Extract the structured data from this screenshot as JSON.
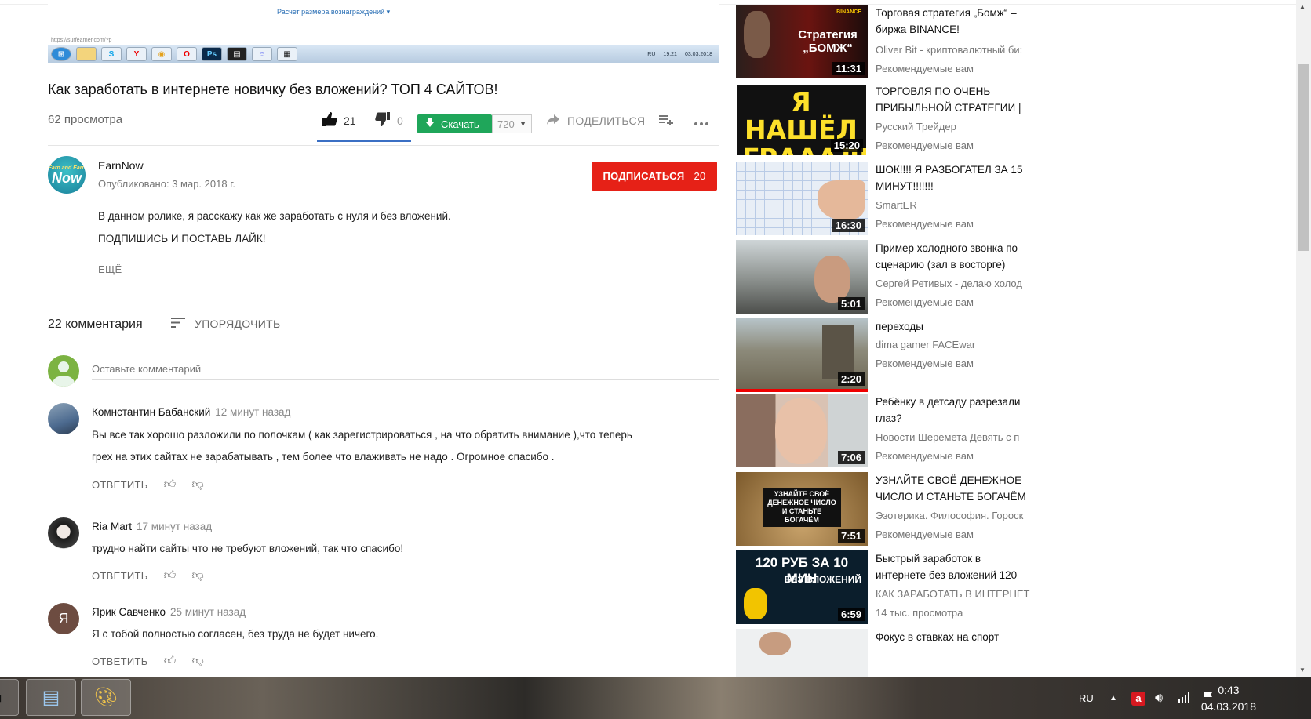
{
  "player": {
    "reward_link": "Расчет размера вознаграждений ▾",
    "url_text": "https://surfearner.com/?p",
    "mini_tray_lang": "RU",
    "mini_tray_time": "19:21",
    "mini_tray_date": "03.03.2018"
  },
  "video": {
    "title": "Как заработать в интернете новичку без вложений? ТОП 4 САЙТОВ!",
    "views": "62 просмотра",
    "likes": "21",
    "dislikes": "0",
    "download_label": "Скачать",
    "quality": "720",
    "share_label": "ПОДЕЛИТЬСЯ"
  },
  "channel": {
    "name": "EarnNow",
    "avatar_small": "Earn and Earn",
    "avatar_big": "Now",
    "published": "Опубликовано: 3 мар. 2018 г.",
    "subscribe_label": "ПОДПИСАТЬСЯ",
    "subscriber_count": "20"
  },
  "description": {
    "line1": "В данном ролике, я расскажу как же заработать с нуля и без вложений.",
    "line2": "ПОДПИШИСЬ И ПОСТАВЬ ЛАЙК!",
    "more": "ЕЩЁ"
  },
  "comments_section": {
    "count": "22 комментария",
    "sort_label": "УПОРЯДОЧИТЬ",
    "input_placeholder": "Оставьте комментарий",
    "reply_label": "ОТВЕТИТЬ",
    "items": [
      {
        "author": "Комнстантин Бабанский",
        "time": "12 минут назад",
        "text1": "Вы все так хорошо разложили по полочкам ( как зарегистрироваться , на что обратить внимание ),что теперь",
        "text2": "грех на этих сайтах не зарабатывать , тем более что влаживать не надо . Огромное спасибо ."
      },
      {
        "author": "Ria Mart",
        "time": "17 минут назад",
        "text1": "трудно найти сайты что не требуют вложений, так что спасибо!"
      },
      {
        "author": "Ярик Савченко",
        "time": "25 минут назад",
        "avatar_letter": "Я",
        "text1": "Я с тобой полностью согласен, без труда не будет ничего."
      }
    ]
  },
  "recommended": [
    {
      "title": "Торговая стратегия „Бомж“ – биржа BINANCE!",
      "channel": "Oliver Bit - криптовалютный би:",
      "meta": "Рекомендуемые вам",
      "duration": "11:31",
      "thumb_text": "Стратегия „БОМЖ“",
      "thumb_small": "BINANCE"
    },
    {
      "title": "ТОРГОВЛЯ ПО ОЧЕНЬ ПРИБЫЛЬНОЙ СТРАТЕГИИ |",
      "channel": "Русский Трейдер",
      "meta": "Рекомендуемые вам",
      "duration": "15:20",
      "thumb_text": "Я НАШЁЛ ГРАААЛЬ"
    },
    {
      "title": "ШОК!!!! Я РАЗБОГАТЕЛ ЗА 15 МИНУТ!!!!!!!",
      "channel": "SmartER",
      "meta": "Рекомендуемые вам",
      "duration": "16:30"
    },
    {
      "title": "Пример холодного звонка по сценарию (зал в восторге)",
      "channel": "Сергей Ретивых - делаю холод",
      "meta": "Рекомендуемые вам",
      "duration": "5:01"
    },
    {
      "title": "переходы",
      "channel": "dima gamer FACEwar",
      "meta": "Рекомендуемые вам",
      "duration": "2:20"
    },
    {
      "title": "Ребёнку в детсаду разрезали глаз?",
      "channel": "Новости Шеремета Девять с п",
      "meta": "Рекомендуемые вам",
      "duration": "7:06"
    },
    {
      "title": "УЗНАЙТЕ СВОЁ ДЕНЕЖНОЕ ЧИСЛО И СТАНЬТЕ БОГАЧЁМ",
      "channel": "Эзотерика. Философия. Гороск",
      "meta": "Рекомендуемые вам",
      "duration": "7:51",
      "thumb_text": "УЗНАЙТЕ СВОЁ ДЕНЕЖНОЕ ЧИСЛО И СТАНЬТЕ БОГАЧЁМ"
    },
    {
      "title": "Быстрый заработок в интернете без вложений 120",
      "channel": "КАК ЗАРАБОТАТЬ В ИНТЕРНЕТ",
      "meta": "14 тыс. просмотра",
      "duration": "6:59",
      "thumb_text": "120 РУБ ЗА 10 МИН",
      "thumb_small": "БЕЗ ВЛОЖЕНИЙ"
    },
    {
      "title": "Фокус в ставках на спорт"
    }
  ],
  "taskbar": {
    "lang": "RU",
    "time": "0:43",
    "date": "04.03.2018"
  },
  "colors": {
    "subscribe_red": "#e62117",
    "download_green": "#1fa65a",
    "like_blue": "#3a6fc4"
  }
}
